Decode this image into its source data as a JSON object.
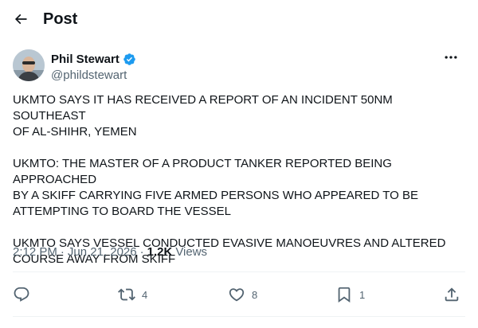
{
  "header": {
    "title": "Post",
    "back_icon": "arrow-left-icon"
  },
  "author": {
    "name": "Phil Stewart",
    "handle": "@phildstewart",
    "verified": true,
    "verified_color": "#1d9bf0"
  },
  "tweet": {
    "paragraphs": [
      "UKMTO SAYS IT HAS RECEIVED A REPORT OF AN INCIDENT 50NM SOUTHEAST\nOF AL-SHIHR, YEMEN",
      "UKMTO: THE MASTER OF A PRODUCT TANKER REPORTED BEING APPROACHED\nBY A SKIFF CARRYING FIVE ARMED PERSONS WHO APPEARED TO BE\nATTEMPTING TO BOARD THE VESSEL",
      "UKMTO SAYS VESSEL CONDUCTED EVASIVE MANOEUVRES AND ALTERED\nCOURSE AWAY FROM SKIFF"
    ]
  },
  "meta": {
    "time": "2:12 PM",
    "separator": "·",
    "date": "Jun 21, 2026",
    "views_count": "1.2K",
    "views_label": "Views"
  },
  "actions": {
    "reply": {
      "icon": "reply-icon",
      "count": ""
    },
    "repost": {
      "icon": "repost-icon",
      "count": "4"
    },
    "like": {
      "icon": "heart-icon",
      "count": "8"
    },
    "bookmark": {
      "icon": "bookmark-icon",
      "count": "1"
    },
    "share": {
      "icon": "share-icon"
    }
  },
  "colors": {
    "text": "#0f1419",
    "secondary": "#536471",
    "divider": "#eff3f4"
  }
}
